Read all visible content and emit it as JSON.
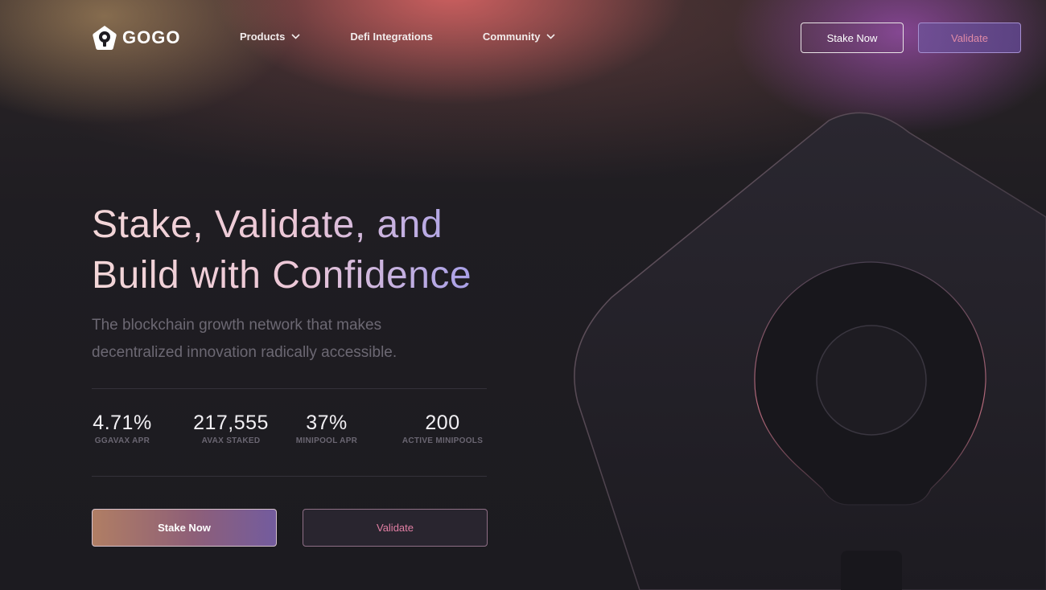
{
  "nav": {
    "logo_text": "GOGO",
    "links": [
      {
        "label": "Products",
        "has_dropdown": true
      },
      {
        "label": "Defi Integrations",
        "has_dropdown": false
      },
      {
        "label": "Community",
        "has_dropdown": true
      }
    ],
    "stake_label": "Stake Now",
    "validate_label": "Validate"
  },
  "hero": {
    "headline_line1": "Stake, Validate, and",
    "headline_line2": "Build with Confidence",
    "subtext_line1": "The blockchain growth network that makes",
    "subtext_line2": "decentralized innovation radically accessible.",
    "stats": [
      {
        "value": "4.71%",
        "label": "GGAVAX APR"
      },
      {
        "value": "217,555",
        "label": "AVAX STAKED"
      },
      {
        "value": "37%",
        "label": "MINIPOOL APR"
      },
      {
        "value": "200",
        "label": "ACTIVE MINIPOOLS"
      }
    ],
    "stake_label": "Stake Now",
    "validate_label": "Validate"
  },
  "colors": {
    "background": "#1e1c22",
    "accent_pink": "#e27fa4",
    "accent_purple": "#735c9e",
    "accent_copper": "#b07e64"
  },
  "icons": {
    "logo": "gogo-logo-icon",
    "dropdown": "chevron-down-icon"
  }
}
